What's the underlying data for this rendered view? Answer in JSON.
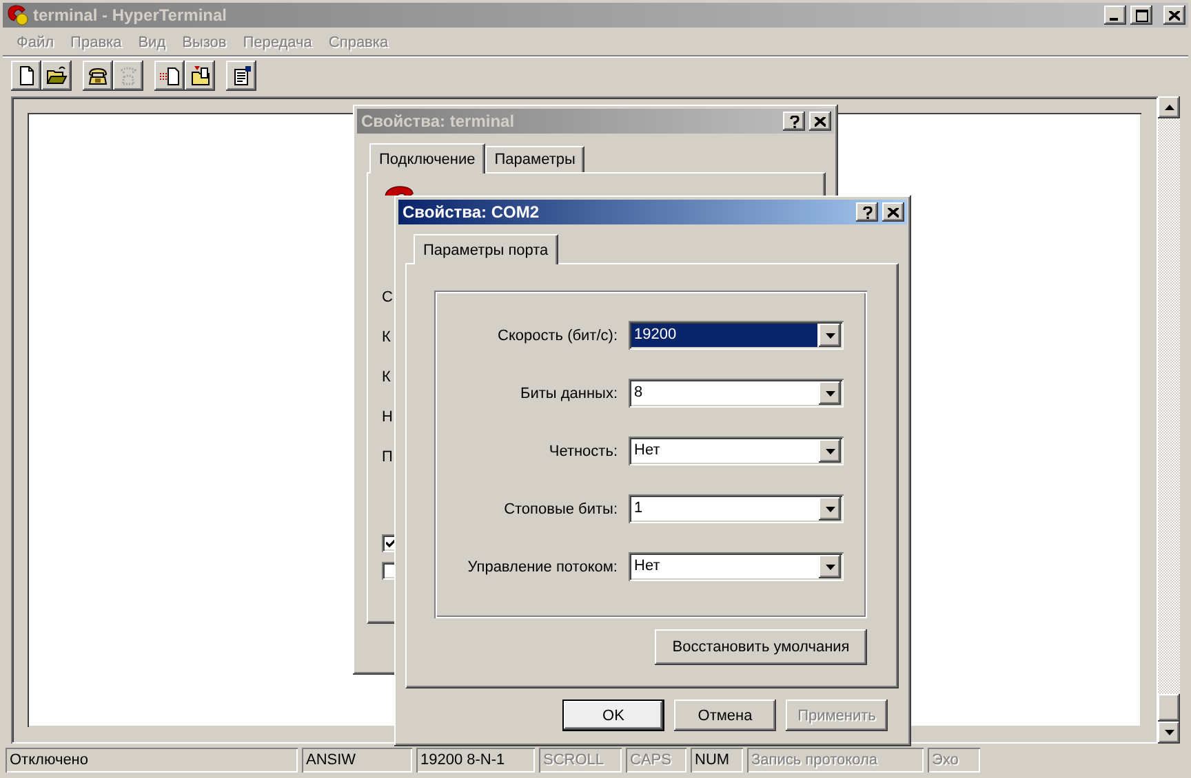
{
  "window": {
    "title": "terminal - HyperTerminal",
    "active": false
  },
  "menu": [
    {
      "label": "Файл",
      "disabled": true
    },
    {
      "label": "Правка",
      "disabled": true
    },
    {
      "label": "Вид",
      "disabled": true
    },
    {
      "label": "Вызов",
      "disabled": true
    },
    {
      "label": "Передача",
      "disabled": true
    },
    {
      "label": "Справка",
      "disabled": true
    }
  ],
  "toolbar": [
    [
      {
        "kind": "new",
        "disabled": false
      },
      {
        "kind": "open",
        "disabled": false
      }
    ],
    [
      {
        "kind": "call",
        "disabled": false
      },
      {
        "kind": "disconnect",
        "disabled": true
      }
    ],
    [
      {
        "kind": "send",
        "disabled": false
      },
      {
        "kind": "receive",
        "disabled": false
      }
    ],
    [
      {
        "kind": "properties",
        "disabled": false
      }
    ]
  ],
  "terminal_dialog": {
    "title": "Свойства: terminal",
    "active": false,
    "tabs": [
      {
        "label": "Подключение",
        "selected": true
      },
      {
        "label": "Параметры",
        "selected": false
      }
    ],
    "label_initials": [
      "С",
      "К",
      "К",
      "Н",
      "П"
    ],
    "checkboxes": [
      {
        "checked": true
      },
      {
        "checked": false
      }
    ]
  },
  "com_dialog": {
    "title": "Свойства: COM2",
    "active": true,
    "tabs": [
      {
        "label": "Параметры порта",
        "selected": true
      }
    ],
    "fields": [
      {
        "label": "Скорость (бит/с):",
        "value": "19200",
        "highlighted": true
      },
      {
        "label": "Биты данных:",
        "value": "8",
        "highlighted": false
      },
      {
        "label": "Четность:",
        "value": "Нет",
        "highlighted": false
      },
      {
        "label": "Стоповые биты:",
        "value": "1",
        "highlighted": false
      },
      {
        "label": "Управление потоком:",
        "value": "Нет",
        "highlighted": false
      }
    ],
    "restore_button": "Восстановить умолчания",
    "buttons": [
      {
        "label": "OK",
        "default": true,
        "disabled": false
      },
      {
        "label": "Отмена",
        "default": false,
        "disabled": false
      },
      {
        "label": "Применить",
        "default": false,
        "disabled": true
      }
    ]
  },
  "status_bar": [
    {
      "text": "Отключено",
      "disabled": false
    },
    {
      "text": "ANSIW",
      "disabled": false
    },
    {
      "text": "19200 8-N-1",
      "disabled": false
    },
    {
      "text": "SCROLL",
      "disabled": true
    },
    {
      "text": "CAPS",
      "disabled": true
    },
    {
      "text": "NUM",
      "disabled": false
    },
    {
      "text": "Запись протокола",
      "disabled": true
    },
    {
      "text": "Эхо",
      "disabled": true
    }
  ]
}
